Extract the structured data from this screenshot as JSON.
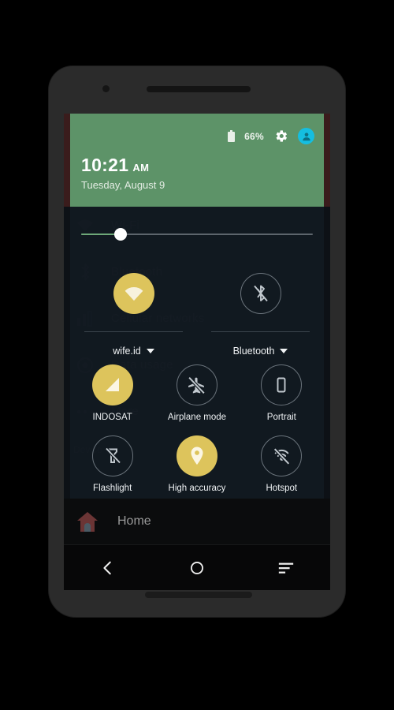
{
  "device": {
    "frame_color": "#2b2b2b",
    "screen_bg": "#0d1116"
  },
  "statusbar": {
    "battery_percent": "66%",
    "battery_icon": "battery-icon",
    "settings_icon": "gear-icon",
    "avatar_icon": "user-avatar-icon"
  },
  "header": {
    "time": "10:21",
    "ampm": "AM",
    "date": "Tuesday, August 9",
    "bg_color": "#5d9368"
  },
  "brightness": {
    "name": "brightness-slider",
    "value_percent": 18,
    "fill_color": "#6ea878",
    "track_color": "#5d656c",
    "knob_color": "#ffffff"
  },
  "primary_toggles": [
    {
      "label": "wife.id",
      "icon": "wifi-icon",
      "state": "on",
      "has_caret": true
    },
    {
      "label": "Bluetooth",
      "icon": "bluetooth-off-icon",
      "state": "off",
      "has_caret": true
    }
  ],
  "tiles": [
    {
      "label": "INDOSAT",
      "icon": "signal-bars-icon",
      "state": "on"
    },
    {
      "label": "Airplane mode",
      "icon": "airplane-off-icon",
      "state": "off"
    },
    {
      "label": "Portrait",
      "icon": "screen-rotation-portrait-icon",
      "state": "off"
    },
    {
      "label": "Flashlight",
      "icon": "flashlight-off-icon",
      "state": "off"
    },
    {
      "label": "High accuracy",
      "icon": "location-pin-icon",
      "state": "on"
    },
    {
      "label": "Hotspot",
      "icon": "hotspot-off-icon",
      "state": "off"
    }
  ],
  "accent": {
    "active_tile": "#ddc45c",
    "inactive_outline": "#6a737b",
    "avatar": "#15bee0"
  },
  "background_app": {
    "rows": [
      {
        "label": "Wi-Fi",
        "icon": "wifi-icon"
      },
      {
        "label": "Bluetooth",
        "icon": "bluetooth-icon"
      },
      {
        "label": "Cellular networks",
        "icon": "signal-bars-icon"
      },
      {
        "label": "Data usage",
        "icon": "data-usage-icon"
      },
      {
        "label": "More",
        "icon": "more-dots-icon"
      }
    ],
    "section_label": "Device",
    "edge_color": "#3a1c1c"
  },
  "home_row": {
    "label": "Home",
    "icon": "home-house-icon"
  },
  "navbar": {
    "back": "back-chevron-icon",
    "home": "home-circle-icon",
    "recents": "menu-lines-icon"
  }
}
